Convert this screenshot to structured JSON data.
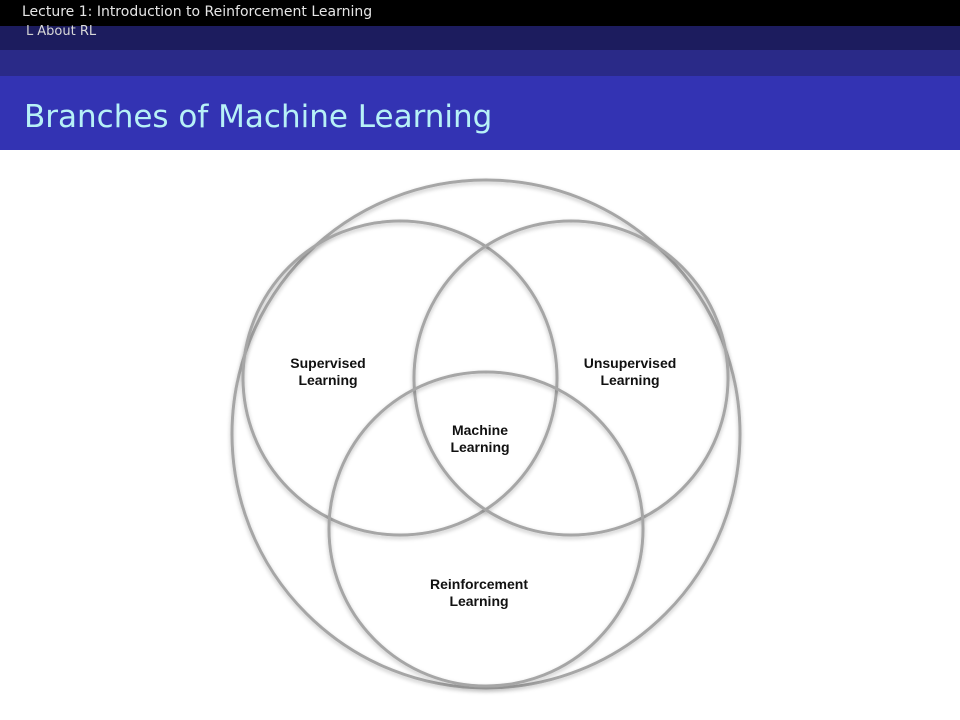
{
  "header": {
    "lecture_title": "Lecture 1: Introduction to Reinforcement Learning",
    "section": "About RL",
    "section_prefix": "L"
  },
  "slide": {
    "title": "Branches of Machine Learning"
  },
  "venn": {
    "supervised_line1": "Supervised",
    "supervised_line2": "Learning",
    "unsupervised_line1": "Unsupervised",
    "unsupervised_line2": "Learning",
    "machine_line1": "Machine",
    "machine_line2": "Learning",
    "reinforcement_line1": "Reinforcement",
    "reinforcement_line2": "Learning"
  },
  "colors": {
    "header_black": "#000000",
    "header_navy": "#1c1c5e",
    "header_mid": "#2a2a88",
    "title_band": "#3333b3",
    "title_text": "#b7f1f7",
    "circle_stroke": "#a6a6a6"
  }
}
